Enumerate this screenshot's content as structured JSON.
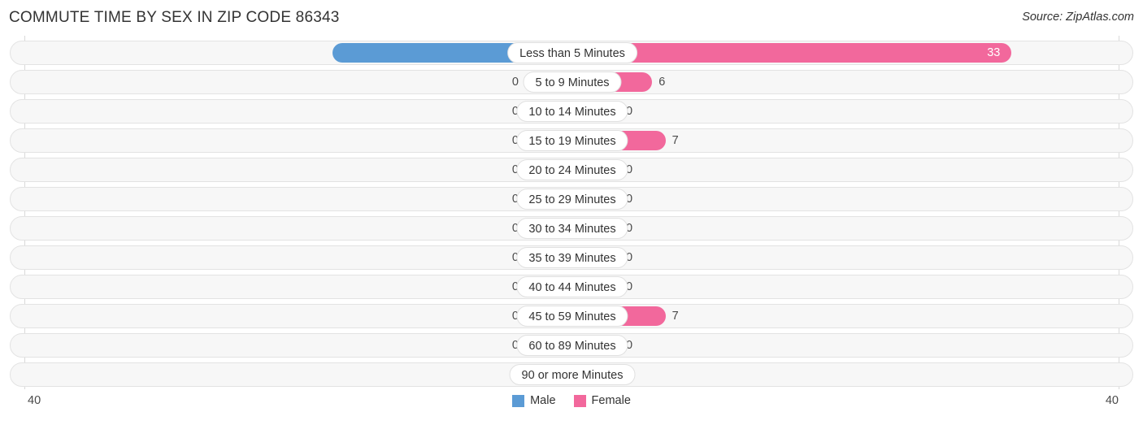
{
  "header": {
    "title": "COMMUTE TIME BY SEX IN ZIP CODE 86343",
    "source": "Source: ZipAtlas.com"
  },
  "axis": {
    "left_label": "40",
    "right_label": "40"
  },
  "legend": {
    "items": [
      {
        "label": "Male",
        "color": "#5B9BD5"
      },
      {
        "label": "Female",
        "color": "#F2689C"
      }
    ]
  },
  "colors": {
    "male": "#5B9BD5",
    "female": "#F2689C",
    "male_zero": "#AEC9EC",
    "female_zero": "#F8AECB",
    "track": "#f7f7f7",
    "track_border": "#e3e3e3",
    "gridline": "#d9d9d9",
    "text": "#333333",
    "value_text": "#4a4a4a",
    "value_text_inside": "#ffffff"
  },
  "chart_data": {
    "type": "bar",
    "title": "COMMUTE TIME BY SEX IN ZIP CODE 86343",
    "subtitle": "",
    "xlabel": "",
    "ylabel": "",
    "orientation": "horizontal-diverging",
    "grid": true,
    "legend_position": "bottom-center",
    "xlim": [
      40,
      40
    ],
    "axis_max": 40,
    "categories": [
      "Less than 5 Minutes",
      "5 to 9 Minutes",
      "10 to 14 Minutes",
      "15 to 19 Minutes",
      "20 to 24 Minutes",
      "25 to 29 Minutes",
      "30 to 34 Minutes",
      "35 to 39 Minutes",
      "40 to 44 Minutes",
      "45 to 59 Minutes",
      "60 to 89 Minutes",
      "90 or more Minutes"
    ],
    "series": [
      {
        "name": "Male",
        "color": "#5B9BD5",
        "direction": "left",
        "values": [
          18,
          0,
          0,
          0,
          0,
          0,
          0,
          0,
          0,
          0,
          0,
          0
        ]
      },
      {
        "name": "Female",
        "color": "#F2689C",
        "direction": "right",
        "values": [
          33,
          6,
          0,
          7,
          0,
          0,
          0,
          0,
          0,
          7,
          0,
          0
        ]
      }
    ]
  }
}
